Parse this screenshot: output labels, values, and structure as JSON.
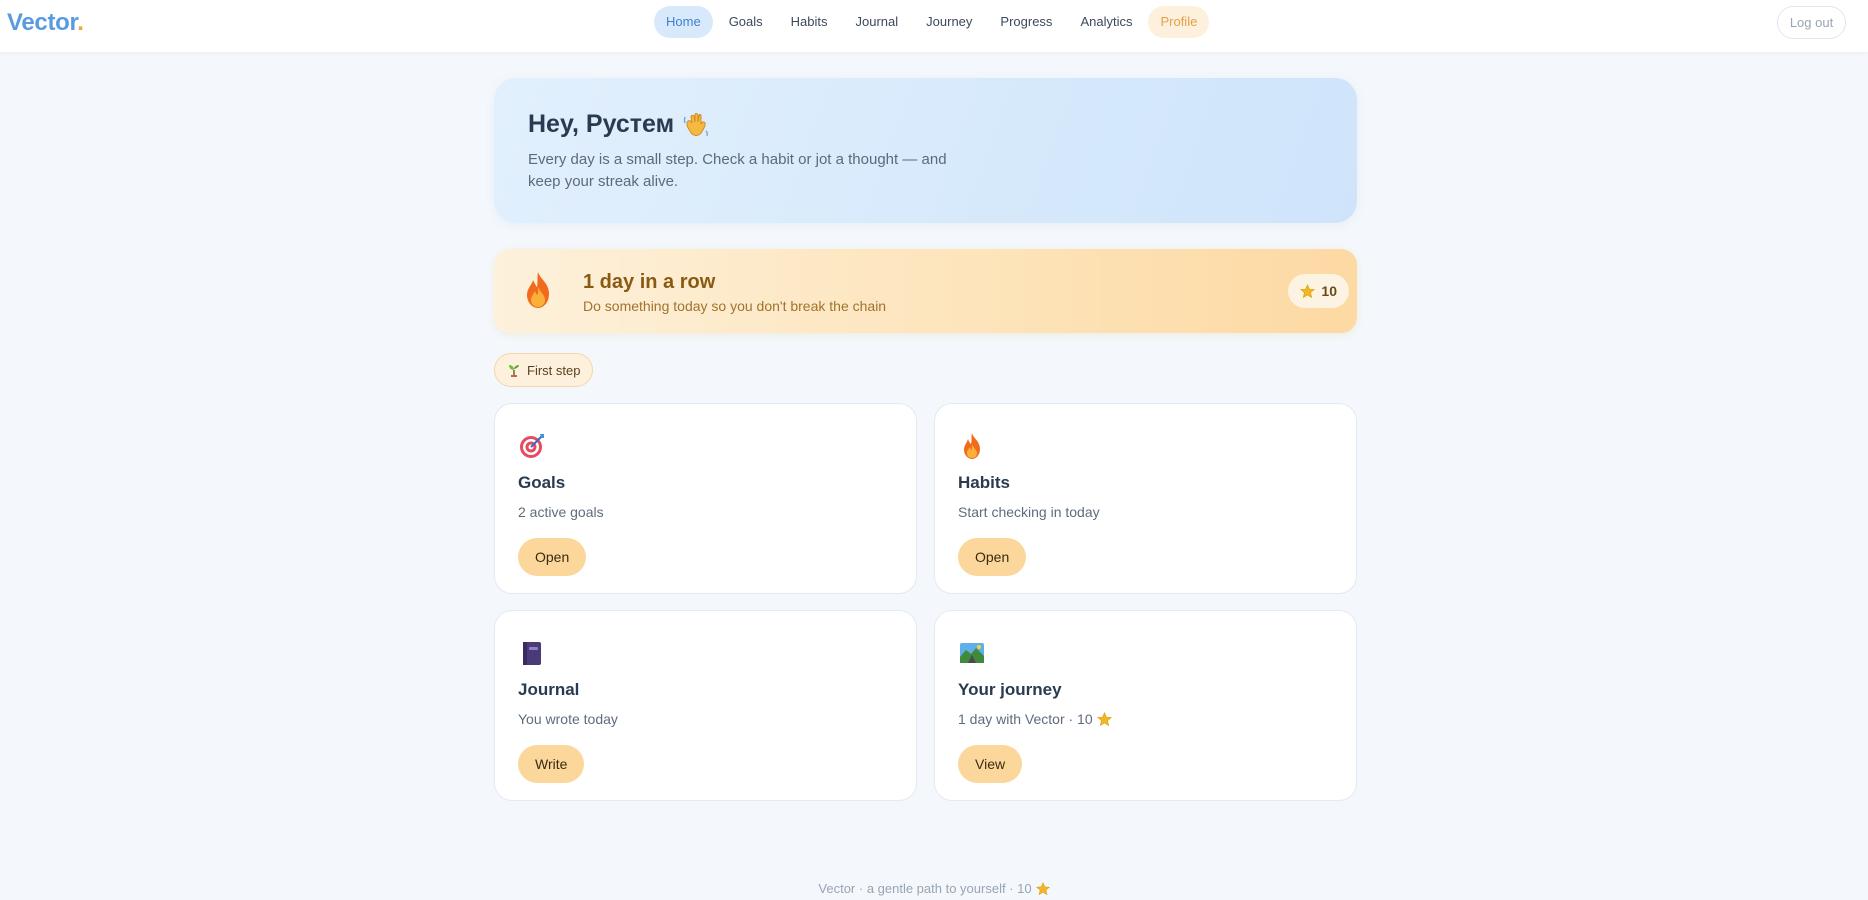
{
  "brand": {
    "name": "Vector",
    "dot": "."
  },
  "nav": {
    "items": [
      {
        "label": "Home"
      },
      {
        "label": "Goals"
      },
      {
        "label": "Habits"
      },
      {
        "label": "Journal"
      },
      {
        "label": "Journey"
      },
      {
        "label": "Progress"
      },
      {
        "label": "Analytics"
      },
      {
        "label": "Profile"
      }
    ],
    "logout": "Log out"
  },
  "hero": {
    "title": "Hey, Рустем",
    "emoji": "waving-hand-icon",
    "text": "Every day is a small step. Check a habit or jot a thought — and keep your streak alive."
  },
  "streak": {
    "title": "1 day in a row",
    "subtitle": "Do something today so you don't break the chain",
    "points": "10"
  },
  "achievement": {
    "label": "First step"
  },
  "cards": [
    {
      "icon": "target-icon",
      "title": "Goals",
      "text": "2 active goals",
      "button": "Open"
    },
    {
      "icon": "fire-icon",
      "title": "Habits",
      "text": "Start checking in today",
      "button": "Open"
    },
    {
      "icon": "notebook-icon",
      "title": "Journal",
      "text": "You wrote today",
      "button": "Write"
    },
    {
      "icon": "landscape-icon",
      "title": "Your journey",
      "text": "1 day with Vector · 10",
      "button": "View"
    }
  ],
  "footer": {
    "text": "Vector · a gentle path to yourself · 10"
  },
  "colors": {
    "accent": "#5a9be0",
    "nav_active_bg": "#d8e9fb",
    "profile_bg": "#fdf0dc",
    "button_bg": "#fcd79c",
    "streak_text": "#8a5a12"
  }
}
